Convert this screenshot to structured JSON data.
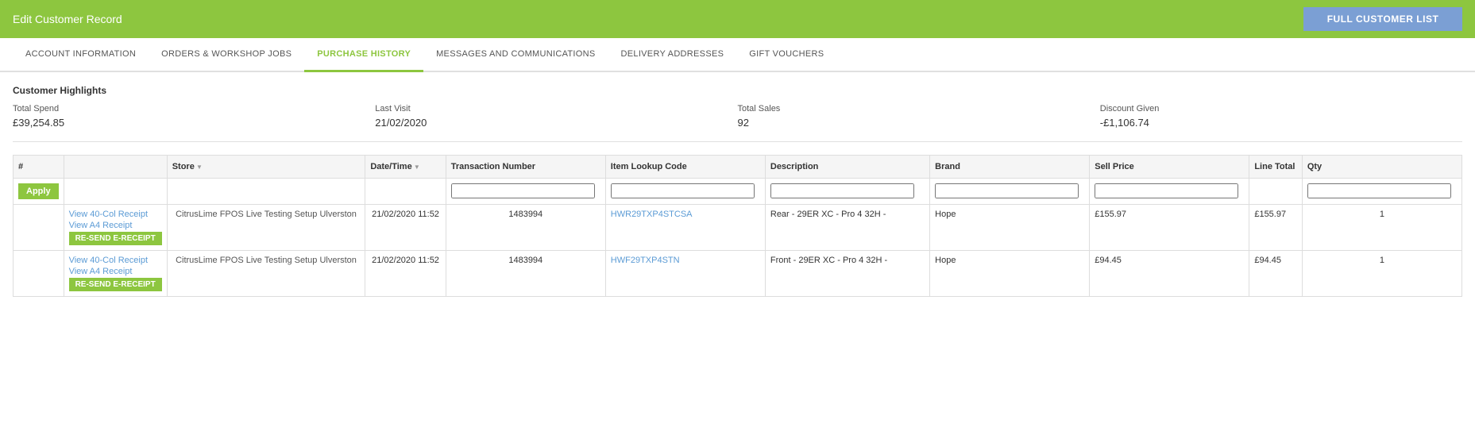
{
  "header": {
    "title": "Edit Customer Record",
    "full_customer_btn": "FULL CUSTOMER LIST"
  },
  "tabs": [
    {
      "id": "account-information",
      "label": "ACCOUNT INFORMATION",
      "active": false
    },
    {
      "id": "orders-workshop-jobs",
      "label": "ORDERS & WORKSHOP JOBS",
      "active": false
    },
    {
      "id": "purchase-history",
      "label": "PURCHASE HISTORY",
      "active": true
    },
    {
      "id": "messages-communications",
      "label": "MESSAGES AND COMMUNICATIONS",
      "active": false
    },
    {
      "id": "delivery-addresses",
      "label": "DELIVERY ADDRESSES",
      "active": false
    },
    {
      "id": "gift-vouchers",
      "label": "GIFT VOUCHERS",
      "active": false
    }
  ],
  "highlights": {
    "title": "Customer Highlights",
    "items": [
      {
        "label": "Total Spend",
        "value": "£39,254.85"
      },
      {
        "label": "Last Visit",
        "value": "21/02/2020"
      },
      {
        "label": "Total Sales",
        "value": "92"
      },
      {
        "label": "Discount Given",
        "value": "-£1,106.74"
      }
    ]
  },
  "table": {
    "columns": [
      {
        "id": "hash",
        "label": "#",
        "sortable": false
      },
      {
        "id": "actions",
        "label": "",
        "sortable": false
      },
      {
        "id": "store",
        "label": "Store",
        "sortable": true
      },
      {
        "id": "datetime",
        "label": "Date/Time",
        "sortable": true
      },
      {
        "id": "transaction",
        "label": "Transaction Number",
        "sortable": false
      },
      {
        "id": "lookup",
        "label": "Item Lookup Code",
        "sortable": false
      },
      {
        "id": "description",
        "label": "Description",
        "sortable": false
      },
      {
        "id": "brand",
        "label": "Brand",
        "sortable": false
      },
      {
        "id": "sell_price",
        "label": "Sell Price",
        "sortable": false
      },
      {
        "id": "line_total",
        "label": "Line Total",
        "sortable": false
      },
      {
        "id": "qty",
        "label": "Qty",
        "sortable": false
      }
    ],
    "apply_label": "Apply",
    "rows": [
      {
        "hash": "",
        "actions": {
          "view40": "View 40-Col Receipt",
          "viewA4": "View A4 Receipt",
          "resend": "RE-SEND E-RECEIPT"
        },
        "store": "CitrusLime FPOS Live Testing Setup Ulverston",
        "datetime": "21/02/2020 11:52",
        "transaction": "1483994",
        "lookup": "HWR29TXP4STCSA",
        "description": "Rear - 29ER XC - Pro 4 32H -",
        "brand": "Hope",
        "sell_price": "£155.97",
        "line_total": "£155.97",
        "qty": "1"
      },
      {
        "hash": "",
        "actions": {
          "view40": "View 40-Col Receipt",
          "viewA4": "View A4 Receipt",
          "resend": "RE-SEND E-RECEIPT"
        },
        "store": "CitrusLime FPOS Live Testing Setup Ulverston",
        "datetime": "21/02/2020 11:52",
        "transaction": "1483994",
        "lookup": "HWF29TXP4STN",
        "description": "Front - 29ER XC - Pro 4 32H -",
        "brand": "Hope",
        "sell_price": "£94.45",
        "line_total": "£94.45",
        "qty": "1"
      }
    ]
  }
}
